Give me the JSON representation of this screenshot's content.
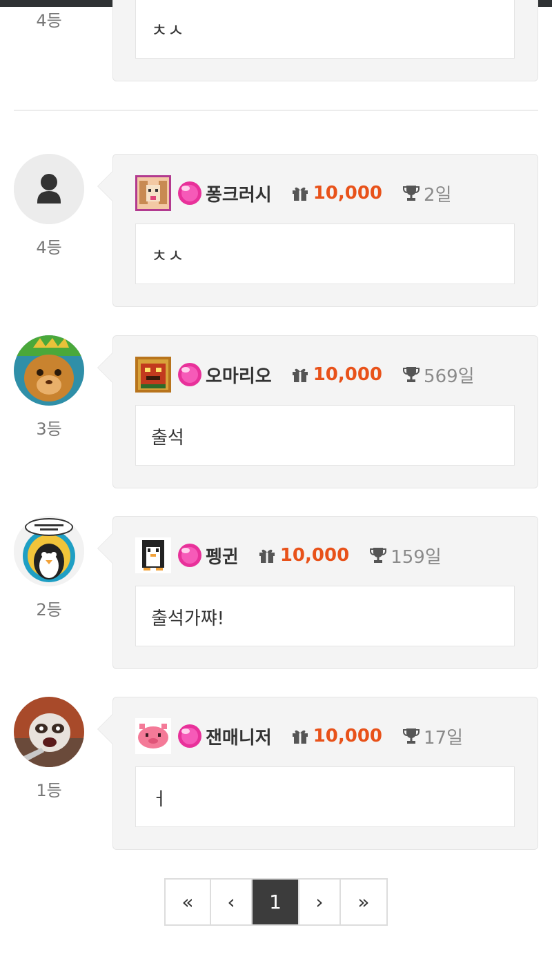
{
  "partial_top": {
    "rank": "4등",
    "message": "ㅊㅅ"
  },
  "entries": [
    {
      "rank": "4등",
      "avatar_icon": "person-placeholder-icon",
      "level_icon": "level-icon-dog",
      "nickname": "퐁크러시",
      "points": "10,000",
      "days": "2일",
      "message": "ㅊㅅ"
    },
    {
      "rank": "3등",
      "avatar_icon": "avatar-cat-photo",
      "level_icon": "level-icon-tiger",
      "nickname": "오마리오",
      "points": "10,000",
      "days": "569일",
      "message": "출석"
    },
    {
      "rank": "2등",
      "avatar_icon": "avatar-penguin-icon",
      "level_icon": "level-icon-penguin",
      "nickname": "펭귄",
      "points": "10,000",
      "days": "159일",
      "message": "출석가쨔!"
    },
    {
      "rank": "1등",
      "avatar_icon": "avatar-raccoon-photo",
      "level_icon": "level-icon-pink-pig",
      "nickname": "잰매니저",
      "points": "10,000",
      "days": "17일",
      "message": "ㅓ"
    }
  ],
  "pagination": {
    "first": "«",
    "prev": "‹",
    "current": "1",
    "next": "›",
    "last": "»"
  },
  "colors": {
    "points": "#e8521a",
    "active_page": "#3c3c3c",
    "card_bg": "#f4f4f4"
  }
}
